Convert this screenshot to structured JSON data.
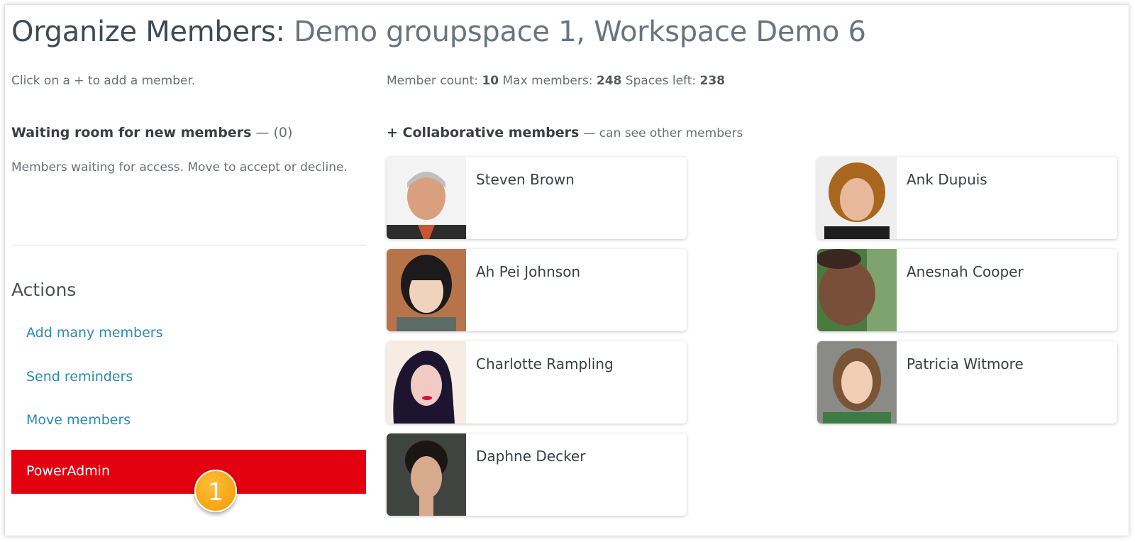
{
  "header": {
    "title_prefix": "Organize Members:",
    "title_space": "Demo groupspace 1, Workspace Demo 6"
  },
  "hint": "Click on a + to add a member.",
  "counts": {
    "member_count_label": "Member count:",
    "member_count": "10",
    "max_members_label": "Max members:",
    "max_members": "248",
    "spaces_left_label": "Spaces left:",
    "spaces_left": "238"
  },
  "waiting_room": {
    "title": "Waiting room for new members",
    "count": "— (0)",
    "description": "Members waiting for access. Move to accept or decline."
  },
  "actions": {
    "title": "Actions",
    "items": [
      {
        "label": "Add many members"
      },
      {
        "label": "Send reminders"
      },
      {
        "label": "Move members"
      }
    ],
    "power_admin": "PowerAdmin",
    "badge": "1"
  },
  "collaborative": {
    "title": "+ Collaborative members",
    "subtitle": "— can see other members",
    "members": [
      {
        "name": "Steven Brown"
      },
      {
        "name": "Ah Pei Johnson"
      },
      {
        "name": "Charlotte Rampling"
      },
      {
        "name": "Daphne Decker"
      },
      {
        "name": "Ank Dupuis"
      },
      {
        "name": "Anesnah Cooper"
      },
      {
        "name": "Patricia Witmore"
      }
    ]
  },
  "colors": {
    "accent_red": "#e3000f",
    "link_blue": "#2a8bb3",
    "badge_orange": "#f5a300"
  }
}
